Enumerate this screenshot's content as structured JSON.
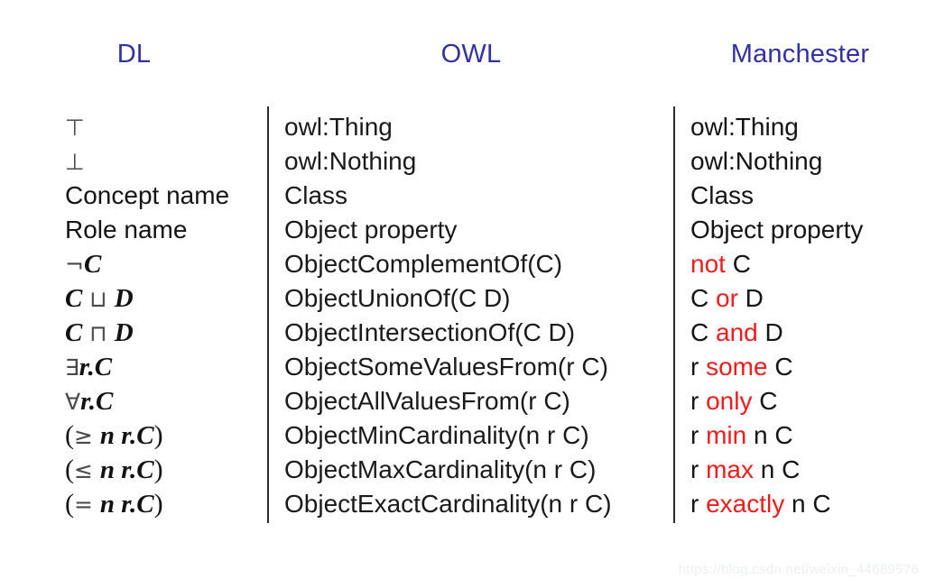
{
  "headers": {
    "dl": "DL",
    "owl": "OWL",
    "manchester": "Manchester",
    "color": "#3231a4"
  },
  "style": {
    "keyword_color": "#ee1d1d",
    "text_color": "#1a1a1a",
    "divider_color": "#2b2b2b",
    "background": "#ffffff"
  },
  "rows": [
    {
      "dl_plain": "⊤",
      "dl_parts": [
        {
          "t": "⊤",
          "k": "sym"
        }
      ],
      "owl": "owl:Thing",
      "manchester_parts": [
        {
          "t": "owl:Thing",
          "k": "plain"
        }
      ]
    },
    {
      "dl_plain": "⊥",
      "dl_parts": [
        {
          "t": "⊥",
          "k": "sym"
        }
      ],
      "owl": "owl:Nothing",
      "manchester_parts": [
        {
          "t": "owl:Nothing",
          "k": "plain"
        }
      ]
    },
    {
      "dl_plain": "Concept name",
      "dl_parts": [
        {
          "t": "Concept name",
          "k": "plain"
        }
      ],
      "owl": "Class",
      "manchester_parts": [
        {
          "t": "Class",
          "k": "plain"
        }
      ]
    },
    {
      "dl_plain": "Role name",
      "dl_parts": [
        {
          "t": "Role name",
          "k": "plain"
        }
      ],
      "owl": "Object property",
      "manchester_parts": [
        {
          "t": "Object property",
          "k": "plain"
        }
      ]
    },
    {
      "dl_plain": "¬C",
      "dl_parts": [
        {
          "t": "¬",
          "k": "sym"
        },
        {
          "t": "C",
          "k": "var"
        }
      ],
      "owl": "ObjectComplementOf(C)",
      "manchester_parts": [
        {
          "t": "not",
          "k": "kw"
        },
        {
          "t": " C",
          "k": "plain"
        }
      ]
    },
    {
      "dl_plain": "C ⊔ D",
      "dl_parts": [
        {
          "t": "C",
          "k": "var"
        },
        {
          "t": " ⊔ ",
          "k": "sym"
        },
        {
          "t": "D",
          "k": "var"
        }
      ],
      "owl": "ObjectUnionOf(C D)",
      "manchester_parts": [
        {
          "t": "C ",
          "k": "plain"
        },
        {
          "t": "or",
          "k": "kw"
        },
        {
          "t": " D",
          "k": "plain"
        }
      ]
    },
    {
      "dl_plain": "C ⊓ D",
      "dl_parts": [
        {
          "t": "C",
          "k": "var"
        },
        {
          "t": " ⊓ ",
          "k": "sym"
        },
        {
          "t": "D",
          "k": "var"
        }
      ],
      "owl": "ObjectIntersectionOf(C D)",
      "manchester_parts": [
        {
          "t": "C ",
          "k": "plain"
        },
        {
          "t": "and",
          "k": "kw"
        },
        {
          "t": " D",
          "k": "plain"
        }
      ]
    },
    {
      "dl_plain": "∃r.C",
      "dl_parts": [
        {
          "t": "∃",
          "k": "sym"
        },
        {
          "t": "r.C",
          "k": "var"
        }
      ],
      "owl": "ObjectSomeValuesFrom(r C)",
      "manchester_parts": [
        {
          "t": "r ",
          "k": "plain"
        },
        {
          "t": "some",
          "k": "kw"
        },
        {
          "t": " C",
          "k": "plain"
        }
      ]
    },
    {
      "dl_plain": "∀r.C",
      "dl_parts": [
        {
          "t": "∀",
          "k": "sym"
        },
        {
          "t": "r.C",
          "k": "var"
        }
      ],
      "owl": "ObjectAllValuesFrom(r C)",
      "manchester_parts": [
        {
          "t": "r ",
          "k": "plain"
        },
        {
          "t": "only",
          "k": "kw"
        },
        {
          "t": " C",
          "k": "plain"
        }
      ]
    },
    {
      "dl_plain": "(≥ n r.C)",
      "dl_parts": [
        {
          "t": "(",
          "k": "paren"
        },
        {
          "t": "≥ ",
          "k": "sym"
        },
        {
          "t": "n r.C",
          "k": "var"
        },
        {
          "t": ")",
          "k": "paren"
        }
      ],
      "owl": "ObjectMinCardinality(n r C)",
      "manchester_parts": [
        {
          "t": "r ",
          "k": "plain"
        },
        {
          "t": "min",
          "k": "kw"
        },
        {
          "t": " n C",
          "k": "plain"
        }
      ]
    },
    {
      "dl_plain": "(≤ n r.C)",
      "dl_parts": [
        {
          "t": "(",
          "k": "paren"
        },
        {
          "t": "≤ ",
          "k": "sym"
        },
        {
          "t": "n r.C",
          "k": "var"
        },
        {
          "t": ")",
          "k": "paren"
        }
      ],
      "owl": "ObjectMaxCardinality(n r C)",
      "manchester_parts": [
        {
          "t": "r ",
          "k": "plain"
        },
        {
          "t": "max",
          "k": "kw"
        },
        {
          "t": " n C",
          "k": "plain"
        }
      ]
    },
    {
      "dl_plain": "(= n r.C)",
      "dl_parts": [
        {
          "t": "(",
          "k": "paren"
        },
        {
          "t": "= ",
          "k": "sym"
        },
        {
          "t": "n r.C",
          "k": "var"
        },
        {
          "t": ")",
          "k": "paren"
        }
      ],
      "owl": "ObjectExactCardinality(n r C)",
      "manchester_parts": [
        {
          "t": "r ",
          "k": "plain"
        },
        {
          "t": "exactly",
          "k": "kw"
        },
        {
          "t": " n C",
          "k": "plain"
        }
      ]
    }
  ],
  "watermark": "https://blog.csdn.net/weixin_44689576"
}
